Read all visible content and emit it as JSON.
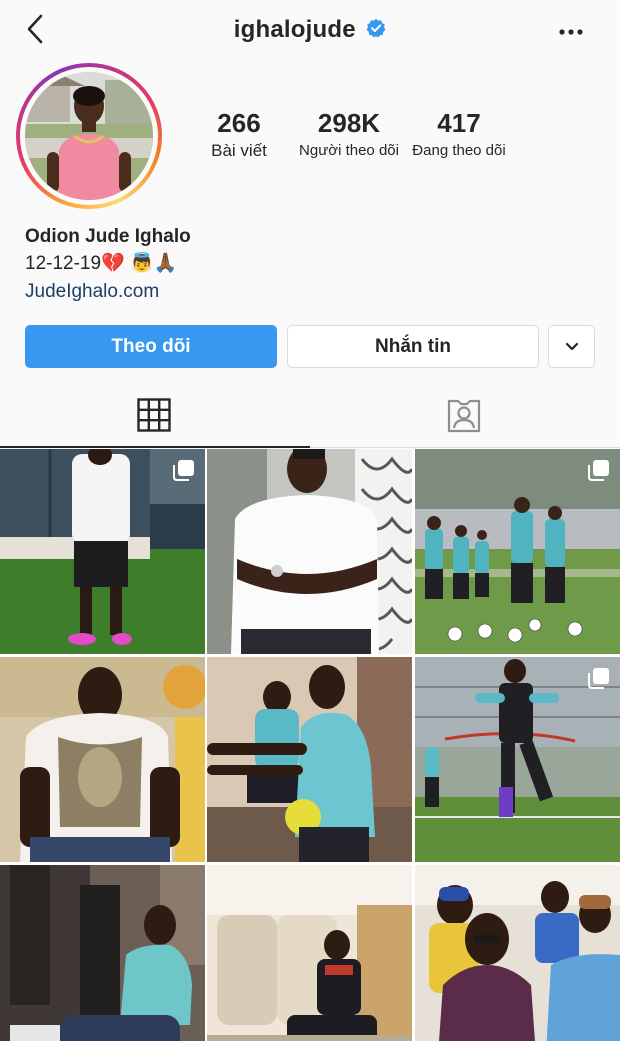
{
  "header": {
    "username": "ighalojude",
    "verified": true,
    "icons": {
      "back": "chevron-left-icon",
      "verified": "verified-badge-icon",
      "more": "ellipsis-icon"
    }
  },
  "profile": {
    "stats": {
      "posts": {
        "value": "266",
        "label": "Bài viết"
      },
      "followers": {
        "value": "298K",
        "label": "Người theo dõi"
      },
      "following": {
        "value": "417",
        "label": "Đang theo dõi"
      }
    },
    "bio": {
      "name": "Odion Jude Ighalo",
      "line": "12-12-19💔 👼🙏🏾",
      "link": "JudeIghalo.com"
    }
  },
  "actions": {
    "follow_label": "Theo dõi",
    "message_label": "Nhắn tin",
    "more_icon": "chevron-down-icon"
  },
  "tabs": [
    {
      "icon": "grid-icon",
      "active": true
    },
    {
      "icon": "tagged-person-icon",
      "active": false
    }
  ],
  "grid": {
    "posts": [
      {
        "subject": "player in white shirt on grass pitch",
        "multi": true
      },
      {
        "subject": "man in white polo arms crossed",
        "multi": false
      },
      {
        "subject": "team training with footballs",
        "multi": true
      },
      {
        "subject": "man in decorated white shirt seated",
        "multi": false
      },
      {
        "subject": "gym workout in teal shirts",
        "multi": false
      },
      {
        "subject": "training drill with resistance band",
        "multi": true
      },
      {
        "subject": "gym machine session",
        "multi": false
      },
      {
        "subject": "airplane first class cabin",
        "multi": false
      },
      {
        "subject": "group photo at event",
        "multi": false
      }
    ]
  },
  "colors": {
    "accent": "#3897f0",
    "verified": "#3897f0",
    "link": "#1e3e66",
    "text": "#262626",
    "border": "#dbdbdb"
  }
}
